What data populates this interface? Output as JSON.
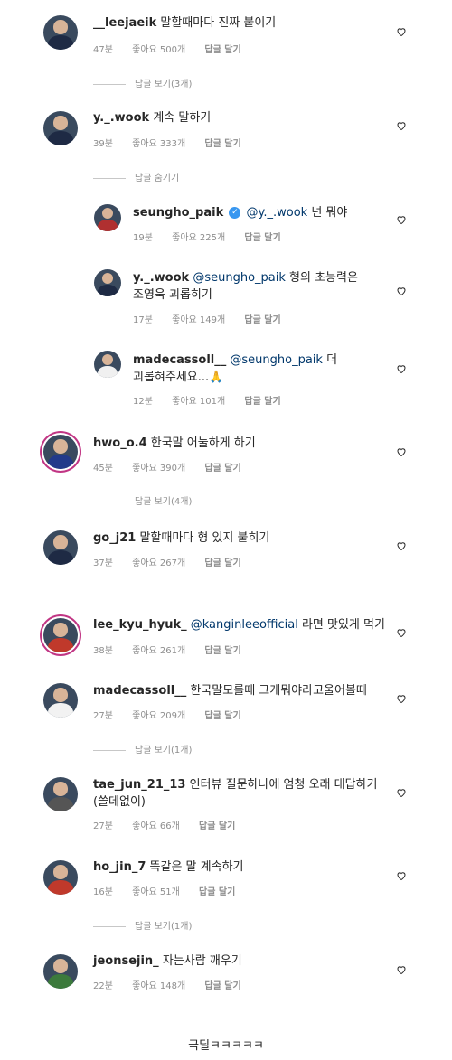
{
  "comments": [
    {
      "username": "__leejaeik",
      "text": "말할때마다 진짜 붙이기",
      "time": "47분",
      "likes": "좋아요 500개",
      "reply": "답글 달기"
    },
    {
      "username": "y._.wook",
      "text": "계속 말하기",
      "time": "39분",
      "likes": "좋아요 333개",
      "reply": "답글 달기"
    },
    {
      "username": "seungho_paik",
      "mention": "@y._.wook",
      "text": " 넌 뭐야",
      "time": "19분",
      "likes": "좋아요 225개",
      "reply": "답글 달기"
    },
    {
      "username": "y._.wook",
      "mention": "@seungho_paik",
      "text": " 형의 초능력은",
      "text2": "조영욱 괴롭히기",
      "time": "17분",
      "likes": "좋아요 149개",
      "reply": "답글 달기"
    },
    {
      "username": "madecassoll__",
      "mention": "@seungho_paik",
      "text": " 더",
      "text2": "괴롭혀주세요...🙏",
      "time": "12분",
      "likes": "좋아요 101개",
      "reply": "답글 달기"
    },
    {
      "username": "hwo_o.4",
      "text": "한국말 어눌하게 하기",
      "time": "45분",
      "likes": "좋아요 390개",
      "reply": "답글 달기"
    },
    {
      "username": "go_j21",
      "text": "말할때마다 형 있지 붙히기",
      "time": "37분",
      "likes": "좋아요 267개",
      "reply": "답글 달기"
    },
    {
      "username": "lee_kyu_hyuk_",
      "mention": "@kanginleeofficial",
      "text": " 라면 맛있게 먹기",
      "time": "38분",
      "likes": "좋아요 261개",
      "reply": "답글 달기"
    },
    {
      "username": "madecassoll__",
      "text": "한국말모를때 그게뭐야라고울어볼때",
      "time": "27분",
      "likes": "좋아요 209개",
      "reply": "답글 달기"
    },
    {
      "username": "tae_jun_21_13",
      "text": "인터뷰 질문하나에 엄청 오래 대답하기",
      "text2": "(쓸데없이)",
      "time": "27분",
      "likes": "좋아요 66개",
      "reply": "답글 달기"
    },
    {
      "username": "ho_jin_7",
      "text": "똑같은 말 계속하기",
      "time": "16분",
      "likes": "좋아요 51개",
      "reply": "답글 달기"
    },
    {
      "username": "jeonsejin_",
      "text": "자는사람 깨우기",
      "time": "22분",
      "likes": "좋아요 148개",
      "reply": "답글 달기"
    }
  ],
  "reply_toggles": [
    "답글 보기(3개)",
    "답글 숨기기",
    "답글 보기(4개)",
    "답글 보기(1개)",
    "답글 보기(1개)"
  ],
  "verified_mark": "✓",
  "footer": "극딜ㅋㅋㅋㅋㅋ",
  "colors": {
    "mention": "#00376b",
    "meta": "#8e8e8e",
    "verified": "#3897f0",
    "ring": "#c13584"
  }
}
